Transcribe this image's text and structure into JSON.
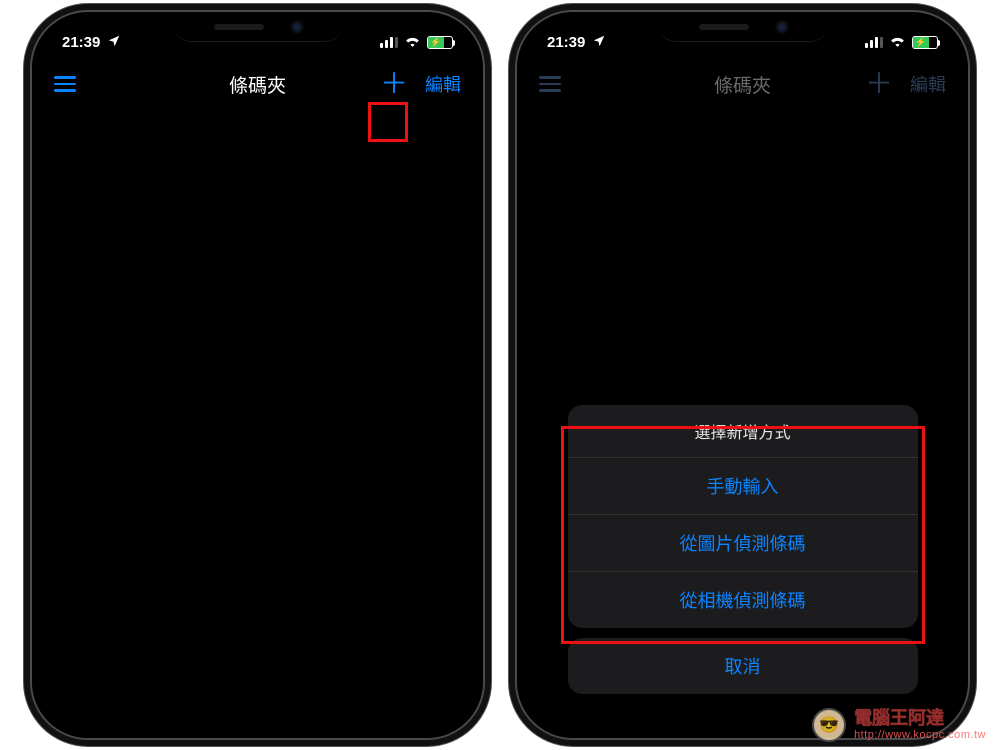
{
  "status": {
    "time": "21:39",
    "location_icon": "location-arrow"
  },
  "nav": {
    "title": "條碼夾",
    "edit": "編輯",
    "add_symbol": "＋"
  },
  "actionsheet": {
    "title": "選擇新增方式",
    "options": {
      "manual": "手動輸入",
      "from_image": "從圖片偵測條碼",
      "from_camera": "從相機偵測條碼"
    },
    "cancel": "取消"
  },
  "watermark": {
    "brand": "電腦王阿達",
    "url": "http://www.kocpc.com.tw"
  }
}
